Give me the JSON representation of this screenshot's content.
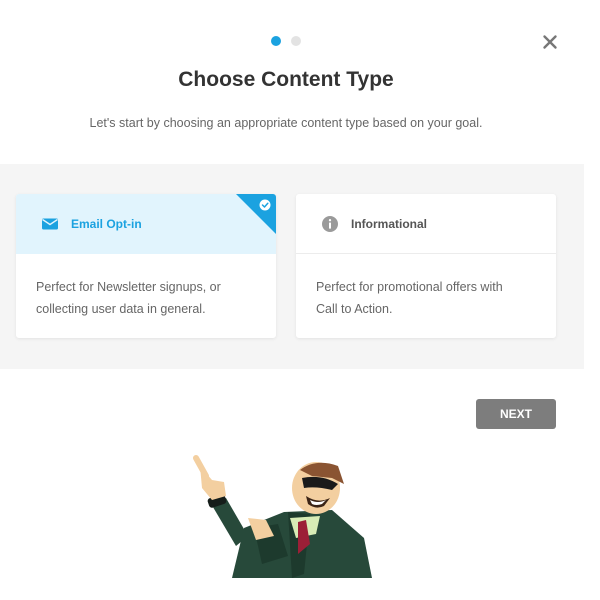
{
  "dialog": {
    "title": "Choose Content Type",
    "subtitle": "Let's start by choosing an appropriate content type based on your goal.",
    "steps": {
      "total": 2,
      "current": 1
    },
    "close_icon": "close-icon"
  },
  "options": [
    {
      "title": "Email Opt-in",
      "icon": "envelope-icon",
      "description_line1": "Perfect for Newsletter signups, or",
      "description_line2": "collecting user data in general.",
      "selected": true
    },
    {
      "title": "Informational",
      "icon": "info-icon",
      "description_line1": "Perfect for promotional offers with",
      "description_line2": "Call to Action.",
      "selected": false
    }
  ],
  "footer": {
    "next_label": "NEXT"
  },
  "colors": {
    "accent": "#1ba2e0",
    "selected_bg": "#e1f4fd",
    "button_bg": "#7d7d7d"
  }
}
